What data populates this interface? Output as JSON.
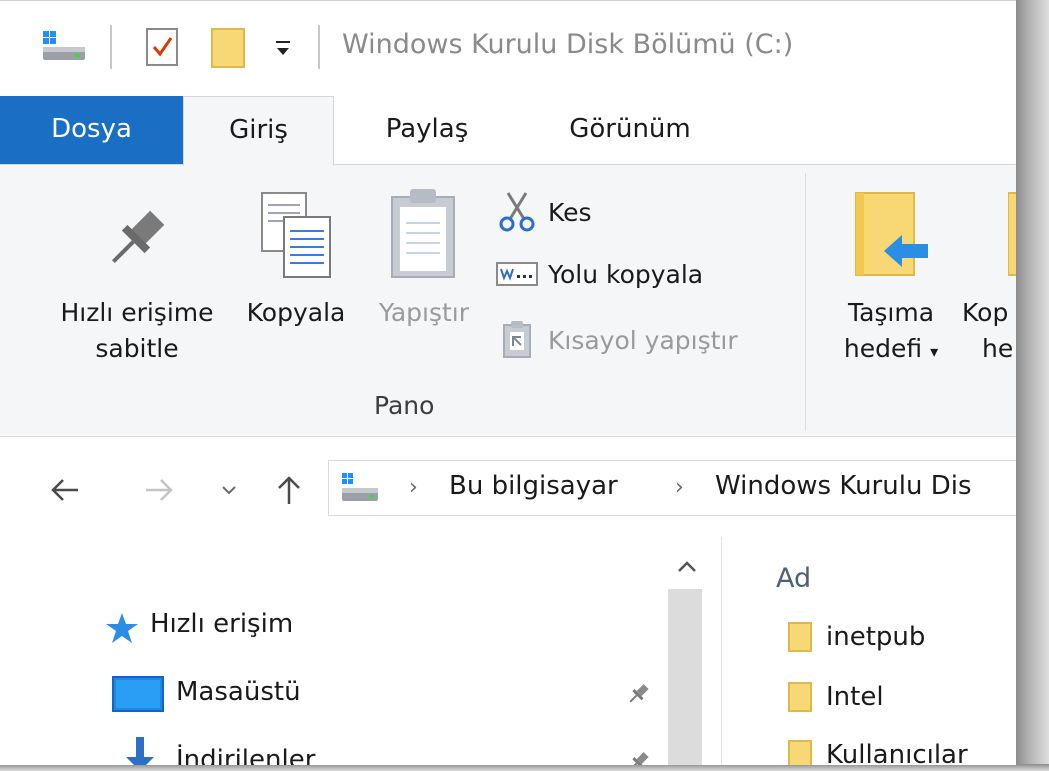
{
  "window": {
    "title": "Windows Kurulu Disk Bölümü (C:)"
  },
  "quick_access": {
    "icons": [
      "drive-icon",
      "properties-icon",
      "new-folder-icon",
      "customize-dropdown-icon"
    ]
  },
  "tabs": [
    {
      "label": "Dosya"
    },
    {
      "label": "Giriş"
    },
    {
      "label": "Paylaş"
    },
    {
      "label": "Görünüm"
    }
  ],
  "ribbon": {
    "pin": {
      "line1": "Hızlı erişime",
      "line2": "sabitle"
    },
    "copy": "Kopyala",
    "paste": "Yapıştır",
    "cut": "Kes",
    "copy_path": "Yolu kopyala",
    "paste_shortcut": "Kısayol yapıştır",
    "group_clipboard": "Pano",
    "move_to": {
      "line1": "Taşıma",
      "line2": "hedefi"
    },
    "copy_to": {
      "line1": "Kop",
      "line2": "he"
    }
  },
  "address": {
    "crumbs": [
      "Bu bilgisayar",
      "Windows Kurulu Dis"
    ]
  },
  "nav_pane": {
    "quick_access": "Hızlı erişim",
    "desktop": "Masaüstü",
    "downloads": "İndirilenler"
  },
  "file_list": {
    "column_name": "Ad",
    "items": [
      "inetpub",
      "Intel",
      "Kullanıcılar"
    ]
  },
  "colors": {
    "file_tab": "#1a6fc4",
    "ribbon_bg": "#f5f6f7",
    "folder": "#f8d775",
    "accent": "#2b8de4"
  }
}
